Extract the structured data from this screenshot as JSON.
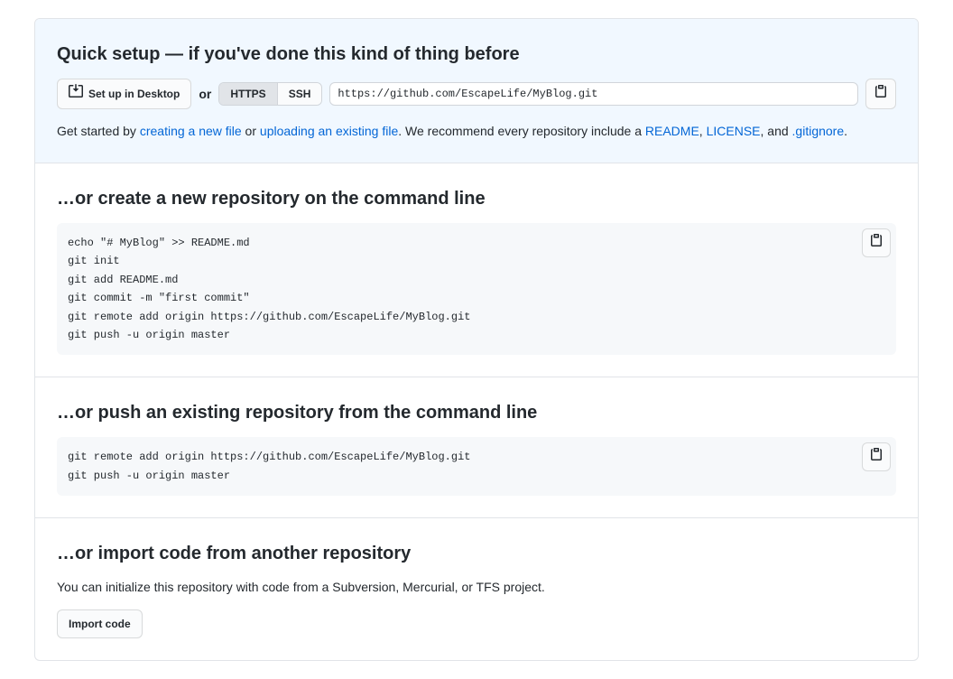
{
  "quick_setup": {
    "heading": "Quick setup — if you've done this kind of thing before",
    "desktop_btn": "Set up in Desktop",
    "or_text": "or",
    "https_label": "HTTPS",
    "ssh_label": "SSH",
    "repo_url": "https://github.com/EscapeLife/MyBlog.git",
    "get_started_prefix": "Get started by ",
    "link_new_file": "creating a new file",
    "or_word": " or ",
    "link_upload": "uploading an existing file",
    "suffix_text": ". We recommend every repository include a ",
    "link_readme": "README",
    "comma": ", ",
    "link_license": "LICENSE",
    "and_text": ", and ",
    "link_gitignore": ".gitignore",
    "period": "."
  },
  "create_section": {
    "heading": "…or create a new repository on the command line",
    "code": "echo \"# MyBlog\" >> README.md\ngit init\ngit add README.md\ngit commit -m \"first commit\"\ngit remote add origin https://github.com/EscapeLife/MyBlog.git\ngit push -u origin master"
  },
  "push_section": {
    "heading": "…or push an existing repository from the command line",
    "code": "git remote add origin https://github.com/EscapeLife/MyBlog.git\ngit push -u origin master"
  },
  "import_section": {
    "heading": "…or import code from another repository",
    "text": "You can initialize this repository with code from a Subversion, Mercurial, or TFS project.",
    "button": "Import code"
  }
}
